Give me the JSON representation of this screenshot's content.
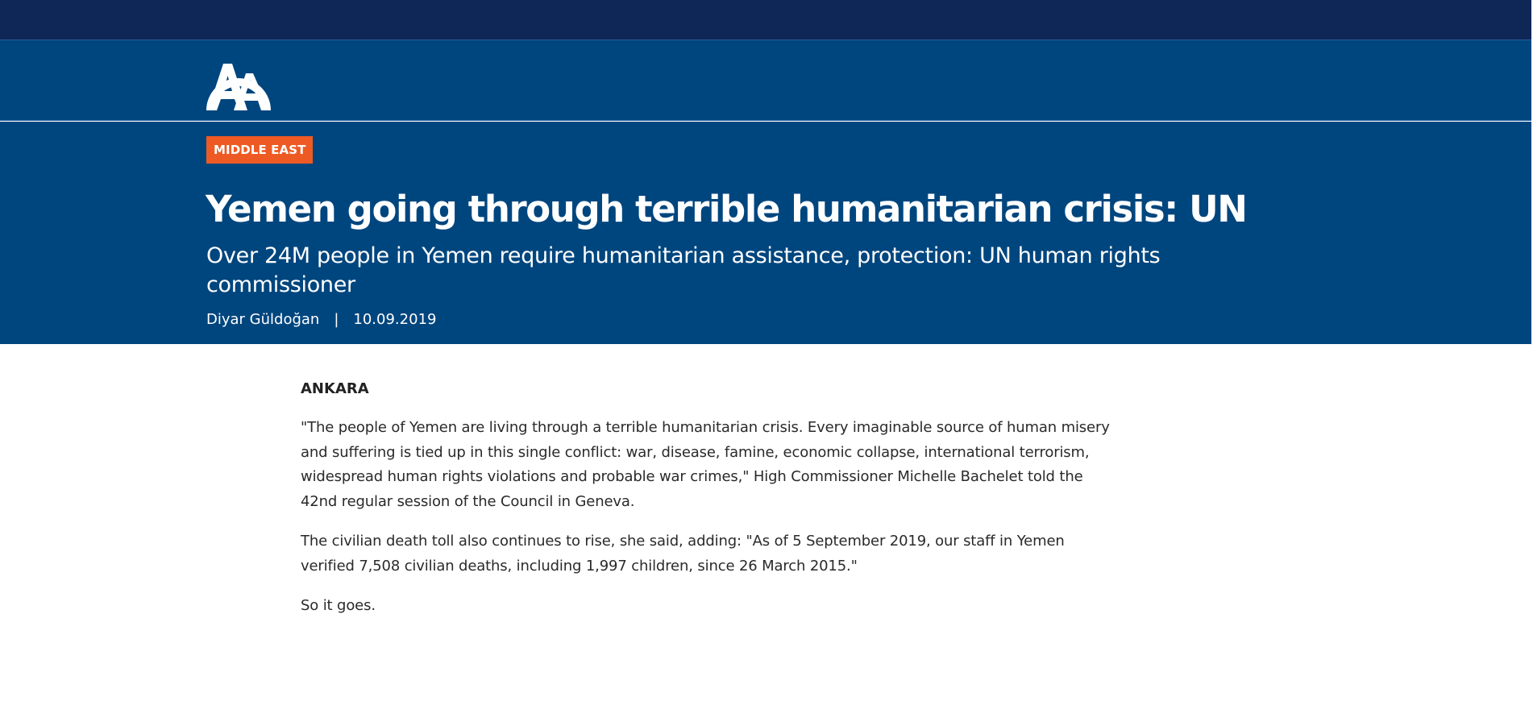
{
  "header": {
    "logo_icon": "aa-logo-icon",
    "colors": {
      "top_bar": "#0e2757",
      "brand_blue": "#00467e",
      "badge": "#ee5a24"
    }
  },
  "article": {
    "category": "MIDDLE EAST",
    "headline": "Yemen going through terrible humanitarian crisis: UN",
    "subtitle": "Over 24M people in Yemen require humanitarian assistance, protection: UN human rights commissioner",
    "author": "Diyar Güldoğan",
    "separator": "|",
    "date": "10.09.2019",
    "dateline": "ANKARA",
    "paragraphs": [
      "\"The people of Yemen are living through a terrible humanitarian crisis. Every imaginable source of human misery and suffering is tied up in this single conflict: war, disease, famine, economic collapse, international terrorism, widespread human rights violations and probable war crimes,\" High Commissioner Michelle Bachelet told the 42nd regular session of the Council in Geneva.",
      "The civilian death toll also continues to rise, she said, adding: \"As of 5 September 2019, our staff in Yemen verified 7,508 civilian deaths, including 1,997 children, since 26 March 2015.\"",
      "So it goes."
    ]
  }
}
